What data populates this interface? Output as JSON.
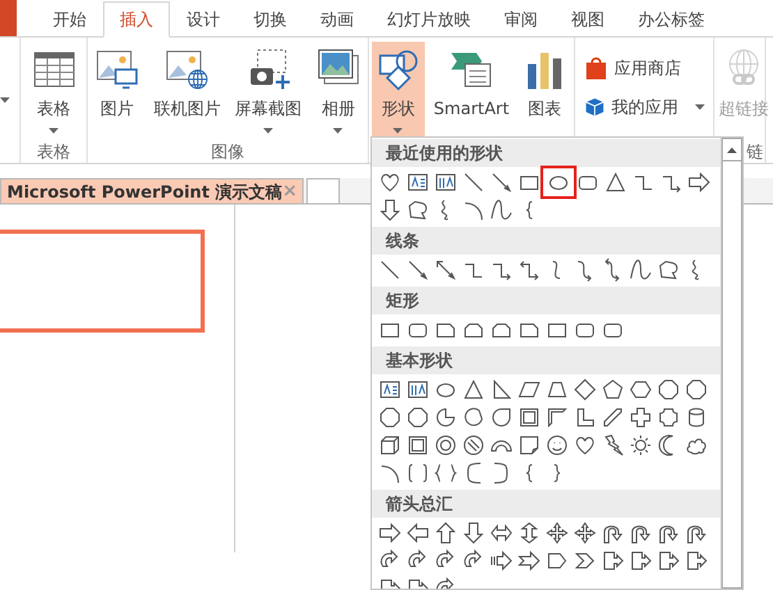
{
  "ribbon_tabs": [
    {
      "label": "开始",
      "selected": false
    },
    {
      "label": "插入",
      "selected": true
    },
    {
      "label": "设计",
      "selected": false
    },
    {
      "label": "切换",
      "selected": false
    },
    {
      "label": "动画",
      "selected": false
    },
    {
      "label": "幻灯片放映",
      "selected": false
    },
    {
      "label": "审阅",
      "selected": false
    },
    {
      "label": "视图",
      "selected": false
    },
    {
      "label": "办公标签",
      "selected": false
    }
  ],
  "ribbon_groups": [
    {
      "kind": "large",
      "label": "表格",
      "buttons": [
        {
          "label": "表格",
          "dropdown": true
        }
      ]
    },
    {
      "kind": "large",
      "label": "图像",
      "buttons": [
        {
          "label": "图片"
        },
        {
          "label": "联机图片"
        },
        {
          "label": "屏幕截图",
          "dropdown": true
        },
        {
          "label": "相册",
          "dropdown": true
        }
      ]
    },
    {
      "kind": "large",
      "buttons": [
        {
          "label": "形状",
          "dropdown": true,
          "pressed": true
        },
        {
          "label": "SmartArt"
        },
        {
          "label": "图表"
        }
      ]
    },
    {
      "kind": "stacked",
      "buttons": [
        {
          "label": "应用商店"
        },
        {
          "label": "我的应用",
          "dropdown": true
        }
      ]
    },
    {
      "kind": "large",
      "label": "链",
      "buttons": [
        {
          "label": "超链接",
          "disabled": true
        }
      ]
    }
  ],
  "document_tab": {
    "title": "Microsoft PowerPoint 演示文稿",
    "close": "×"
  },
  "shapes_menu": {
    "sections": [
      {
        "title": "最近使用的形状",
        "shapes": [
          {
            "selected": false
          },
          {
            "selected": false
          },
          {
            "selected": false
          },
          {
            "selected": false
          },
          {
            "selected": false
          },
          {
            "selected": false
          },
          {
            "selected": true
          },
          {
            "selected": false
          },
          {
            "selected": false
          },
          {
            "selected": false
          },
          {
            "selected": false
          },
          {
            "selected": false
          },
          {
            "selected": false
          },
          {
            "selected": false
          },
          {
            "selected": false
          },
          {
            "selected": false
          },
          {
            "selected": false
          },
          {
            "selected": false
          }
        ]
      },
      {
        "title": "线条",
        "shapes": [
          {
            "selected": false
          },
          {
            "selected": false
          },
          {
            "selected": false
          },
          {
            "selected": false
          },
          {
            "selected": false
          },
          {
            "selected": false
          },
          {
            "selected": false
          },
          {
            "selected": false
          },
          {
            "selected": false
          },
          {
            "selected": false
          },
          {
            "selected": false
          },
          {
            "selected": false
          }
        ]
      },
      {
        "title": "矩形",
        "shapes": [
          {
            "selected": false
          },
          {
            "selected": false
          },
          {
            "selected": false
          },
          {
            "selected": false
          },
          {
            "selected": false
          },
          {
            "selected": false
          },
          {
            "selected": false
          },
          {
            "selected": false
          },
          {
            "selected": false
          }
        ]
      },
      {
        "title": "基本形状",
        "shapes": [
          {
            "selected": false
          },
          {
            "selected": false
          },
          {
            "selected": false
          },
          {
            "selected": false
          },
          {
            "selected": false
          },
          {
            "selected": false
          },
          {
            "selected": false
          },
          {
            "selected": false
          },
          {
            "selected": false
          },
          {
            "selected": false
          },
          {
            "selected": false
          },
          {
            "selected": false
          },
          {
            "selected": false
          },
          {
            "selected": false
          },
          {
            "selected": false
          },
          {
            "selected": false
          },
          {
            "selected": false
          },
          {
            "selected": false
          },
          {
            "selected": false
          },
          {
            "selected": false
          },
          {
            "selected": false
          },
          {
            "selected": false
          },
          {
            "selected": false
          },
          {
            "selected": false
          },
          {
            "selected": false
          },
          {
            "selected": false
          },
          {
            "selected": false
          },
          {
            "selected": false
          },
          {
            "selected": false
          },
          {
            "selected": false
          },
          {
            "selected": false
          },
          {
            "selected": false
          },
          {
            "selected": false
          },
          {
            "selected": false
          },
          {
            "selected": false
          },
          {
            "selected": false
          },
          {
            "selected": false
          },
          {
            "selected": false
          },
          {
            "selected": false
          },
          {
            "selected": false
          },
          {
            "selected": false
          },
          {
            "selected": false
          },
          {
            "selected": false
          }
        ]
      },
      {
        "title": "箭头总汇",
        "shapes": [
          {
            "selected": false
          },
          {
            "selected": false
          },
          {
            "selected": false
          },
          {
            "selected": false
          },
          {
            "selected": false
          },
          {
            "selected": false
          },
          {
            "selected": false
          },
          {
            "selected": false
          },
          {
            "selected": false
          },
          {
            "selected": false
          },
          {
            "selected": false
          },
          {
            "selected": false
          },
          {
            "selected": false
          },
          {
            "selected": false
          },
          {
            "selected": false
          },
          {
            "selected": false
          },
          {
            "selected": false
          },
          {
            "selected": false
          },
          {
            "selected": false
          },
          {
            "selected": false
          },
          {
            "selected": false
          },
          {
            "selected": false
          },
          {
            "selected": false
          },
          {
            "selected": false
          },
          {
            "selected": false
          },
          {
            "selected": false
          },
          {
            "selected": false
          }
        ]
      }
    ]
  }
}
